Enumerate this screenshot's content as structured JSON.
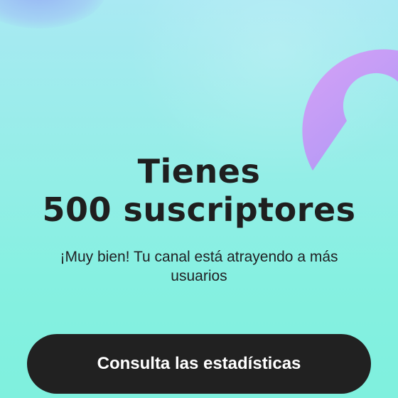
{
  "milestone": {
    "headline_line1": "Tienes",
    "headline_line2": "500 suscriptores",
    "subtitle": "¡Muy bien! Tu canal está atrayendo a más usuarios",
    "cta_label": "Consulta las estadísticas"
  },
  "colors": {
    "background_top": "#a9e9f3",
    "background_bottom": "#7ff0de",
    "ring_purple": "#c39af7",
    "button_bg": "#212121",
    "button_text": "#ffffff"
  },
  "icons": {
    "decor": [
      "ring-decoration",
      "blob-decoration"
    ]
  }
}
